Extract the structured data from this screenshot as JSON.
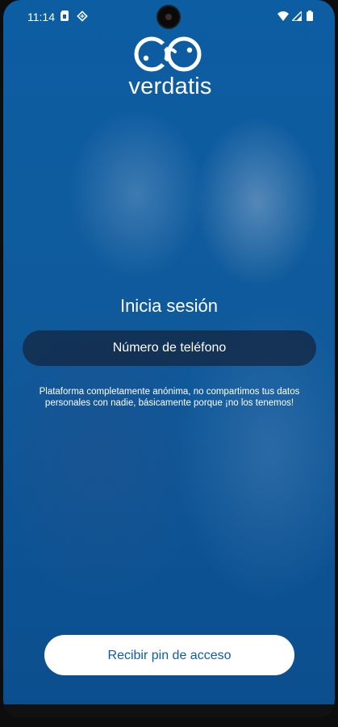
{
  "status_bar": {
    "time": "11:14",
    "icons": [
      "sim-card-icon",
      "app-notification-icon",
      "wifi-icon",
      "cellular-signal-icon",
      "battery-icon"
    ]
  },
  "brand": {
    "name": "verdatis",
    "logo_icon": "verdatis-logo-icon"
  },
  "login": {
    "title": "Inicia sesión",
    "phone_placeholder": "Número de teléfono",
    "phone_value": "",
    "disclaimer": "Plataforma completamente anónima, no compartimos tus datos personales con nadie, básicamente porque ¡no los tenemos!",
    "submit_label": "Recibir pin de acceso"
  },
  "colors": {
    "primary_blue": "#0d5da3",
    "input_bg": "#14233c",
    "button_bg": "#ffffff",
    "text": "#ffffff"
  }
}
